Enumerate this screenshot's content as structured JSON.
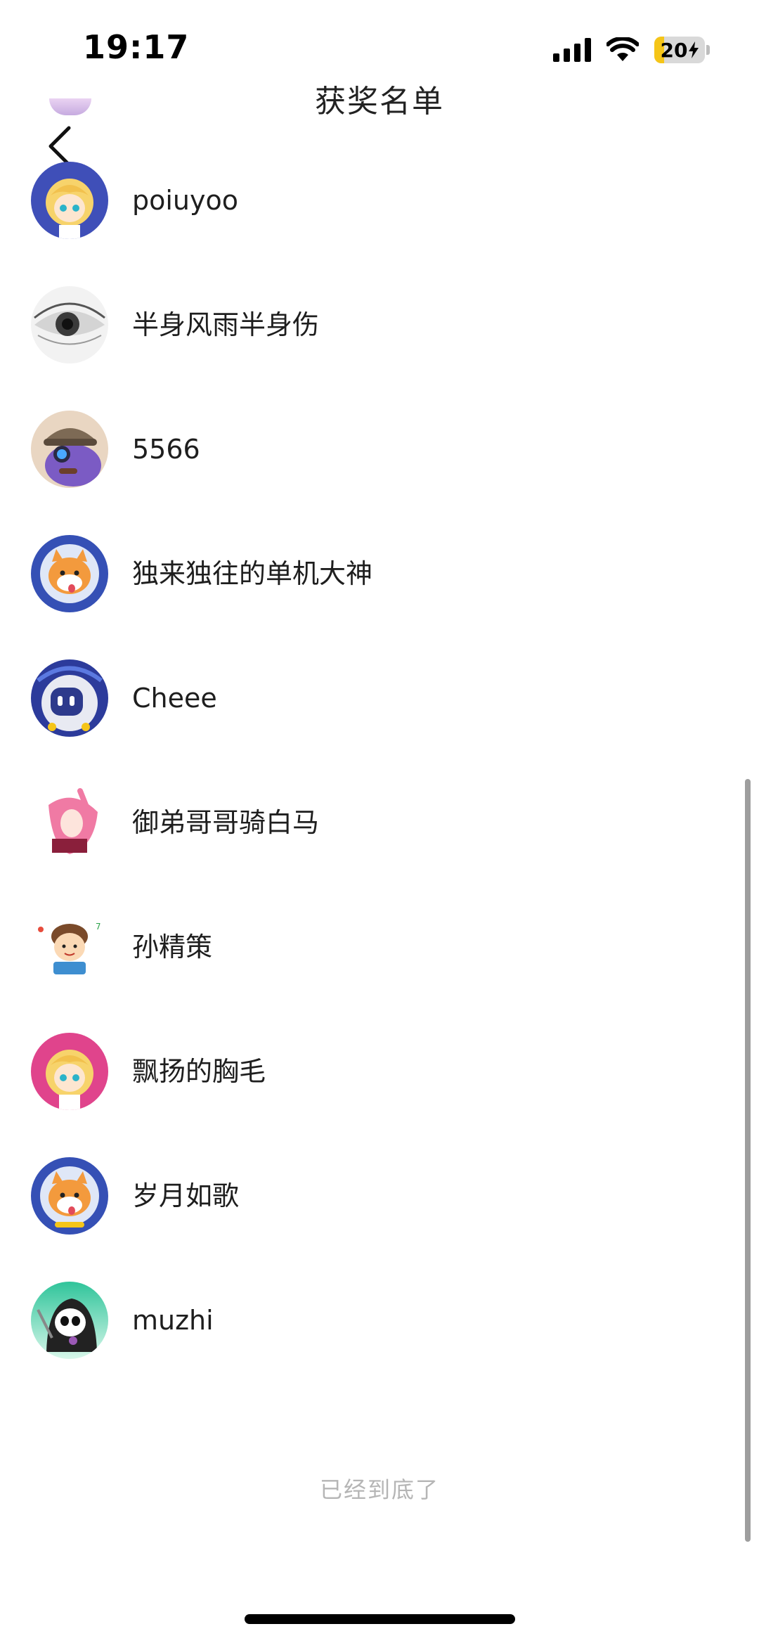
{
  "status_bar": {
    "time": "19:17",
    "battery_level": "20",
    "battery_fraction": 0.2,
    "signal_icon": "cellular-signal-icon",
    "wifi_icon": "wifi-icon",
    "battery_icon": "battery-charging-icon"
  },
  "header": {
    "title": "获奖名单",
    "back_icon": "chevron-left-icon"
  },
  "winners": [
    {
      "name": "poiuyoo",
      "avatar": "anime-girl-avatar"
    },
    {
      "name": "半身风雨半身伤",
      "avatar": "eye-avatar"
    },
    {
      "name": "5566",
      "avatar": "detective-cat-avatar"
    },
    {
      "name": "独来独往的单机大神",
      "avatar": "shiba-astronaut-avatar"
    },
    {
      "name": "Cheee",
      "avatar": "robot-avatar"
    },
    {
      "name": "御弟哥哥骑白马",
      "avatar": "pink-hair-character-avatar"
    },
    {
      "name": "孙精策",
      "avatar": "cartoon-boy-avatar"
    },
    {
      "name": "飘扬的胸毛",
      "avatar": "anime-girl-pink-avatar"
    },
    {
      "name": "岁月如歌",
      "avatar": "shiba-astronaut-avatar"
    },
    {
      "name": "muzhi",
      "avatar": "panda-reaper-avatar"
    }
  ],
  "footer": {
    "end_text": "已经到底了"
  },
  "colors": {
    "background": "#ffffff",
    "text_primary": "#1e1e1e",
    "text_muted": "#b5b5b5",
    "battery_accent": "#f5c518"
  }
}
